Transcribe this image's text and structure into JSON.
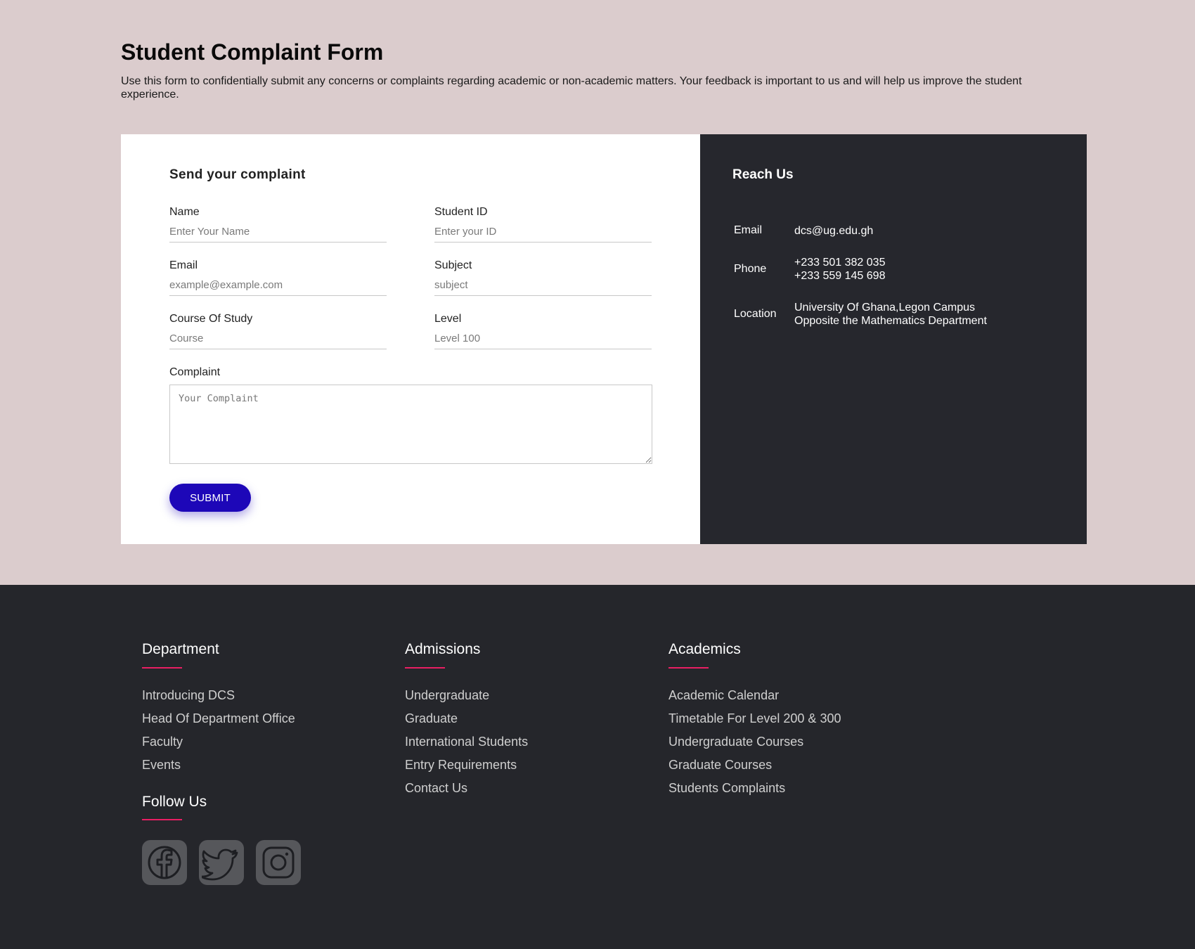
{
  "page": {
    "title": "Student Complaint Form",
    "description": "Use this form to confidentially submit any concerns or complaints regarding academic or non-academic matters. Your feedback is important to us and will help us improve the student experience."
  },
  "form": {
    "heading": "Send your complaint",
    "name": {
      "label": "Name",
      "placeholder": "Enter Your Name",
      "value": ""
    },
    "student_id": {
      "label": "Student ID",
      "placeholder": "Enter your ID",
      "value": ""
    },
    "email": {
      "label": "Email",
      "placeholder": "example@example.com",
      "value": ""
    },
    "subject": {
      "label": "Subject",
      "placeholder": "subject",
      "value": ""
    },
    "course": {
      "label": "Course Of Study",
      "placeholder": "Course",
      "value": ""
    },
    "level": {
      "label": "Level",
      "placeholder": "Level 100",
      "value": ""
    },
    "complaint": {
      "label": "Complaint",
      "placeholder": "Your Complaint",
      "value": ""
    },
    "submit_label": "SUBMIT"
  },
  "contact": {
    "title": "Reach Us",
    "email_key": "Email",
    "email_value": "dcs@ug.edu.gh",
    "phone_key": "Phone",
    "phone_1": "+233 501 382 035",
    "phone_2": "+233 559 145 698",
    "location_key": "Location",
    "location_1": "University Of Ghana,Legon Campus",
    "location_2": "Opposite the Mathematics Department"
  },
  "footer": {
    "department": {
      "title": "Department",
      "items": [
        "Introducing DCS",
        "Head Of Department Office",
        "Faculty",
        "Events"
      ]
    },
    "admissions": {
      "title": "Admissions",
      "items": [
        "Undergraduate",
        "Graduate",
        "International Students",
        "Entry Requirements",
        "Contact Us"
      ]
    },
    "academics": {
      "title": "Academics",
      "items": [
        "Academic Calendar",
        "Timetable For Level 200 & 300",
        "Undergraduate Courses",
        "Graduate Courses",
        "Students Complaints"
      ]
    },
    "follow_title": "Follow Us",
    "socials": [
      "facebook-icon",
      "twitter-icon",
      "instagram-icon"
    ]
  },
  "colors": {
    "page_bg": "#dbcccd",
    "panel_dark": "#26272d",
    "submit": "#1d07b8",
    "accent": "#e91e63"
  }
}
